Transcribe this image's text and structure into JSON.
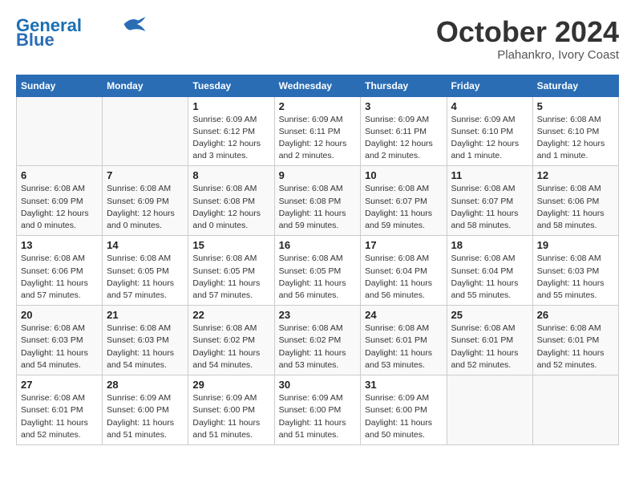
{
  "header": {
    "logo_line1": "General",
    "logo_line2": "Blue",
    "month": "October 2024",
    "location": "Plahankro, Ivory Coast"
  },
  "days_of_week": [
    "Sunday",
    "Monday",
    "Tuesday",
    "Wednesday",
    "Thursday",
    "Friday",
    "Saturday"
  ],
  "weeks": [
    [
      {
        "day": "",
        "info": ""
      },
      {
        "day": "",
        "info": ""
      },
      {
        "day": "1",
        "info": "Sunrise: 6:09 AM\nSunset: 6:12 PM\nDaylight: 12 hours and 3 minutes."
      },
      {
        "day": "2",
        "info": "Sunrise: 6:09 AM\nSunset: 6:11 PM\nDaylight: 12 hours and 2 minutes."
      },
      {
        "day": "3",
        "info": "Sunrise: 6:09 AM\nSunset: 6:11 PM\nDaylight: 12 hours and 2 minutes."
      },
      {
        "day": "4",
        "info": "Sunrise: 6:09 AM\nSunset: 6:10 PM\nDaylight: 12 hours and 1 minute."
      },
      {
        "day": "5",
        "info": "Sunrise: 6:08 AM\nSunset: 6:10 PM\nDaylight: 12 hours and 1 minute."
      }
    ],
    [
      {
        "day": "6",
        "info": "Sunrise: 6:08 AM\nSunset: 6:09 PM\nDaylight: 12 hours and 0 minutes."
      },
      {
        "day": "7",
        "info": "Sunrise: 6:08 AM\nSunset: 6:09 PM\nDaylight: 12 hours and 0 minutes."
      },
      {
        "day": "8",
        "info": "Sunrise: 6:08 AM\nSunset: 6:08 PM\nDaylight: 12 hours and 0 minutes."
      },
      {
        "day": "9",
        "info": "Sunrise: 6:08 AM\nSunset: 6:08 PM\nDaylight: 11 hours and 59 minutes."
      },
      {
        "day": "10",
        "info": "Sunrise: 6:08 AM\nSunset: 6:07 PM\nDaylight: 11 hours and 59 minutes."
      },
      {
        "day": "11",
        "info": "Sunrise: 6:08 AM\nSunset: 6:07 PM\nDaylight: 11 hours and 58 minutes."
      },
      {
        "day": "12",
        "info": "Sunrise: 6:08 AM\nSunset: 6:06 PM\nDaylight: 11 hours and 58 minutes."
      }
    ],
    [
      {
        "day": "13",
        "info": "Sunrise: 6:08 AM\nSunset: 6:06 PM\nDaylight: 11 hours and 57 minutes."
      },
      {
        "day": "14",
        "info": "Sunrise: 6:08 AM\nSunset: 6:05 PM\nDaylight: 11 hours and 57 minutes."
      },
      {
        "day": "15",
        "info": "Sunrise: 6:08 AM\nSunset: 6:05 PM\nDaylight: 11 hours and 57 minutes."
      },
      {
        "day": "16",
        "info": "Sunrise: 6:08 AM\nSunset: 6:05 PM\nDaylight: 11 hours and 56 minutes."
      },
      {
        "day": "17",
        "info": "Sunrise: 6:08 AM\nSunset: 6:04 PM\nDaylight: 11 hours and 56 minutes."
      },
      {
        "day": "18",
        "info": "Sunrise: 6:08 AM\nSunset: 6:04 PM\nDaylight: 11 hours and 55 minutes."
      },
      {
        "day": "19",
        "info": "Sunrise: 6:08 AM\nSunset: 6:03 PM\nDaylight: 11 hours and 55 minutes."
      }
    ],
    [
      {
        "day": "20",
        "info": "Sunrise: 6:08 AM\nSunset: 6:03 PM\nDaylight: 11 hours and 54 minutes."
      },
      {
        "day": "21",
        "info": "Sunrise: 6:08 AM\nSunset: 6:03 PM\nDaylight: 11 hours and 54 minutes."
      },
      {
        "day": "22",
        "info": "Sunrise: 6:08 AM\nSunset: 6:02 PM\nDaylight: 11 hours and 54 minutes."
      },
      {
        "day": "23",
        "info": "Sunrise: 6:08 AM\nSunset: 6:02 PM\nDaylight: 11 hours and 53 minutes."
      },
      {
        "day": "24",
        "info": "Sunrise: 6:08 AM\nSunset: 6:01 PM\nDaylight: 11 hours and 53 minutes."
      },
      {
        "day": "25",
        "info": "Sunrise: 6:08 AM\nSunset: 6:01 PM\nDaylight: 11 hours and 52 minutes."
      },
      {
        "day": "26",
        "info": "Sunrise: 6:08 AM\nSunset: 6:01 PM\nDaylight: 11 hours and 52 minutes."
      }
    ],
    [
      {
        "day": "27",
        "info": "Sunrise: 6:08 AM\nSunset: 6:01 PM\nDaylight: 11 hours and 52 minutes."
      },
      {
        "day": "28",
        "info": "Sunrise: 6:09 AM\nSunset: 6:00 PM\nDaylight: 11 hours and 51 minutes."
      },
      {
        "day": "29",
        "info": "Sunrise: 6:09 AM\nSunset: 6:00 PM\nDaylight: 11 hours and 51 minutes."
      },
      {
        "day": "30",
        "info": "Sunrise: 6:09 AM\nSunset: 6:00 PM\nDaylight: 11 hours and 51 minutes."
      },
      {
        "day": "31",
        "info": "Sunrise: 6:09 AM\nSunset: 6:00 PM\nDaylight: 11 hours and 50 minutes."
      },
      {
        "day": "",
        "info": ""
      },
      {
        "day": "",
        "info": ""
      }
    ]
  ]
}
